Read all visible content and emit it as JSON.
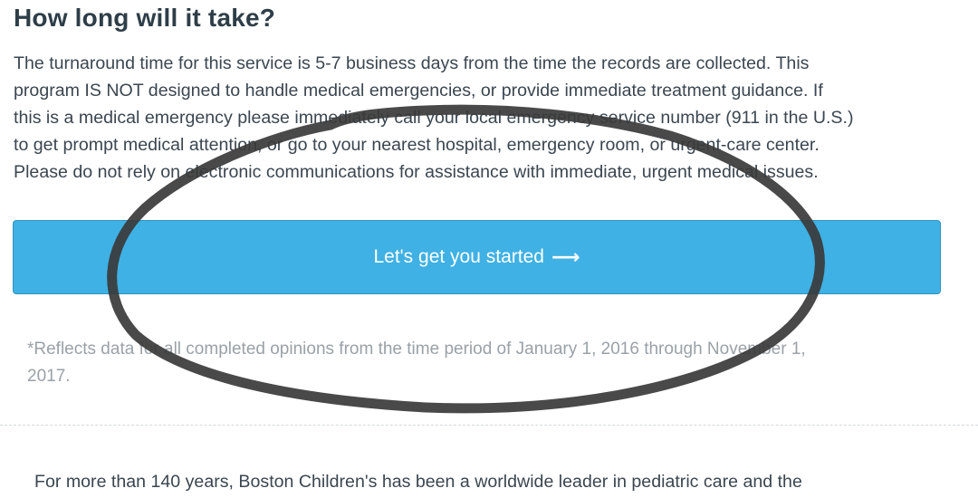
{
  "section": {
    "heading": "How long will it take?",
    "paragraph_lines": [
      "The turnaround time for this service is 5-7 business days from the time the records are collected. This",
      "program IS NOT designed to handle medical emergencies, or provide immediate treatment guidance. If",
      "this is a medical emergency please immediately call your local emergency service number (911 in the U.S.)",
      "to get prompt medical attention, or go to your nearest hospital, emergency room, or urgent-care center.",
      "Please do not rely on electronic communications for assistance with immediate, urgent medical issues."
    ]
  },
  "cta": {
    "label": "Let's get you started",
    "arrow": "⟶",
    "color": "#3fb1e4"
  },
  "footnote": {
    "lines": [
      "*Reflects data for all completed opinions from the time period of January 1, 2016 through November 1,",
      "2017."
    ]
  },
  "about": {
    "text": "For more than 140 years, Boston Children's has been a worldwide leader in pediatric care and the"
  },
  "annotation": {
    "stroke_color": "#3a3a3a"
  }
}
